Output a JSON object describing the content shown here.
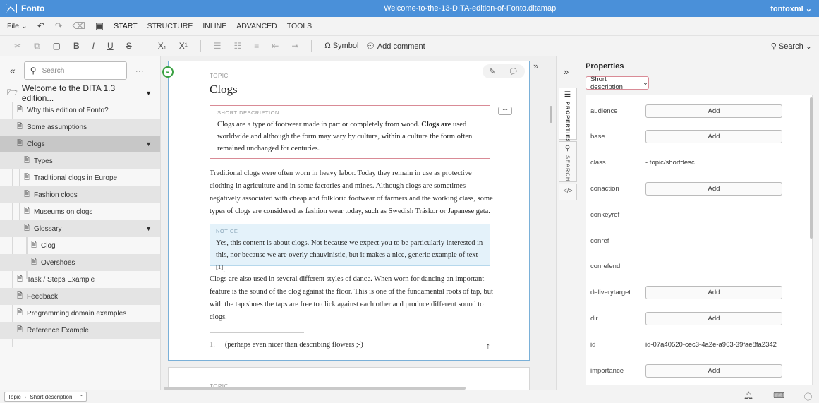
{
  "app": {
    "name": "Fonto",
    "document_title": "Welcome-to-the-13-DITA-edition-of-Fonto.ditamap",
    "user": "fontoxml"
  },
  "tabs": {
    "file": "File",
    "items": [
      "START",
      "STRUCTURE",
      "INLINE",
      "ADVANCED",
      "TOOLS"
    ]
  },
  "toolbar": {
    "symbol": "Symbol",
    "add_comment": "Add comment",
    "search": "Search"
  },
  "outline": {
    "search_placeholder": "Search",
    "root": "Welcome to the DITA 1.3 edition...",
    "items": [
      {
        "label": "Why this edition of Fonto?"
      },
      {
        "label": "Some assumptions"
      },
      {
        "label": "Clogs"
      },
      {
        "label": "Types"
      },
      {
        "label": "Traditional clogs in Europe"
      },
      {
        "label": "Fashion clogs"
      },
      {
        "label": "Museums on clogs"
      },
      {
        "label": "Glossary"
      },
      {
        "label": "Clog"
      },
      {
        "label": "Overshoes"
      },
      {
        "label": "Task / Steps Example"
      },
      {
        "label": "Feedback"
      },
      {
        "label": "Programming domain examples"
      },
      {
        "label": "Reference Example"
      }
    ]
  },
  "editor": {
    "topic_label": "TOPIC",
    "title": "Clogs",
    "short_desc_label": "SHORT DESCRIPTION",
    "short_desc_a": "Clogs are a type of footwear made in part or completely from wood.",
    "short_desc_bold": "Clogs are",
    "short_desc_b": "used worldwide and although the form may vary by culture, within a culture the form often remained unchanged for centuries.",
    "paragraph1": "Traditional clogs were often worn in heavy labor. Today they remain in use as protective clothing in agriculture and in some factories and mines. Although clogs are sometimes negatively associated with cheap and folkloric footwear of farmers and the working class, some types of clogs are considered as fashion wear today, such as Swedish Träskor or Japanese geta.",
    "notice_label": "NOTICE",
    "notice_text": "Yes, this content is about clogs. Not because we expect you to be particularly interested in this, nor because we are overly chauvinistic, but it makes a nice, generic example of text",
    "notice_ref": "[1]",
    "notice_end": ".",
    "paragraph2": "Clogs are also used in several different styles of dance. When worn for dancing an important feature is the sound of the clog against the floor. This is one of the fundamental roots of tap, but with the tap shoes the taps are free to click against each other and produce different sound to clogs.",
    "footnote_num": "1.",
    "footnote_text": "(perhaps even nicer than describing flowers ;-)",
    "next_topic_label": "TOPIC"
  },
  "sidetabs": {
    "properties": "PROPERTIES",
    "search": "SEARCH"
  },
  "properties": {
    "title": "Properties",
    "selector": "Short description",
    "add_label": "Add",
    "rows": [
      {
        "name": "audience",
        "type": "add"
      },
      {
        "name": "base",
        "type": "add"
      },
      {
        "name": "class",
        "type": "value",
        "value": "- topic/shortdesc"
      },
      {
        "name": "conaction",
        "type": "add"
      },
      {
        "name": "conkeyref",
        "type": "empty"
      },
      {
        "name": "conref",
        "type": "empty"
      },
      {
        "name": "conrefend",
        "type": "empty"
      },
      {
        "name": "deliverytarget",
        "type": "add"
      },
      {
        "name": "dir",
        "type": "add"
      },
      {
        "name": "id",
        "type": "value",
        "value": "id-07a40520-cec3-4a2e-a963-39fae8fa2342"
      },
      {
        "name": "importance",
        "type": "add"
      }
    ]
  },
  "status": {
    "crumb1": "Topic",
    "crumb2": "Short description"
  }
}
